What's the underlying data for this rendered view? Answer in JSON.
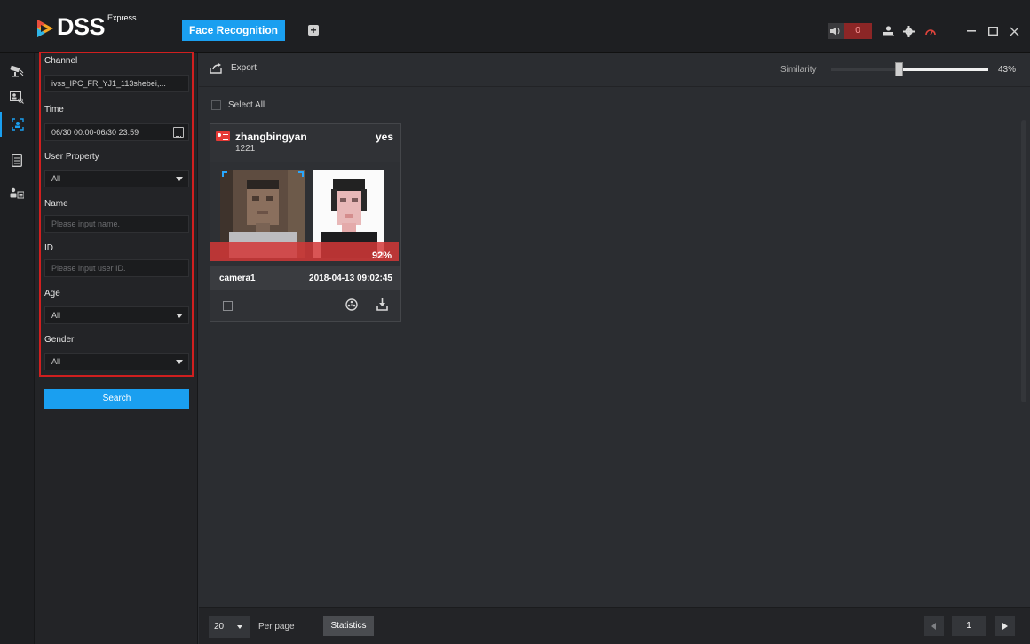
{
  "app": {
    "brand": "DSS",
    "brand_sup": "Express",
    "active_tab": "Face Recognition",
    "add_tab_symbol": "+",
    "alarm_count": "0",
    "accent": "#1a9ff0",
    "highlight": "#d01f1f"
  },
  "rail": {
    "items": [
      {
        "icon": "surveillance-icon"
      },
      {
        "icon": "face-search-icon"
      },
      {
        "icon": "face-recognition-icon"
      },
      {
        "icon": "report-icon"
      },
      {
        "icon": "user-list-icon"
      }
    ]
  },
  "filters": {
    "channel_label": "Channel",
    "channel_value": "ivss_IPC_FR_YJ1_113shebei,...",
    "time_label": "Time",
    "time_value": "06/30 00:00-06/30 23:59",
    "user_property_label": "User Property",
    "user_property_value": "All",
    "name_label": "Name",
    "name_placeholder": "Please input name.",
    "id_label": "ID",
    "id_placeholder": "Please input user ID.",
    "age_label": "Age",
    "age_value": "All",
    "gender_label": "Gender",
    "gender_value": "All",
    "search_label": "Search"
  },
  "toolbar": {
    "export_label": "Export",
    "similarity_label": "Similarity",
    "similarity_value": "43%",
    "similarity_fraction": 0.43
  },
  "results": {
    "select_all_label": "Select All",
    "cards": [
      {
        "name": "zhangbingyan",
        "status": "yes",
        "id": "1221",
        "similarity": "92%",
        "camera": "camera1",
        "time": "2018-04-13 09:02:45"
      }
    ]
  },
  "pagination": {
    "per_page_value": "20",
    "per_page_label": "Per page",
    "statistics_label": "Statistics",
    "page": "1"
  }
}
